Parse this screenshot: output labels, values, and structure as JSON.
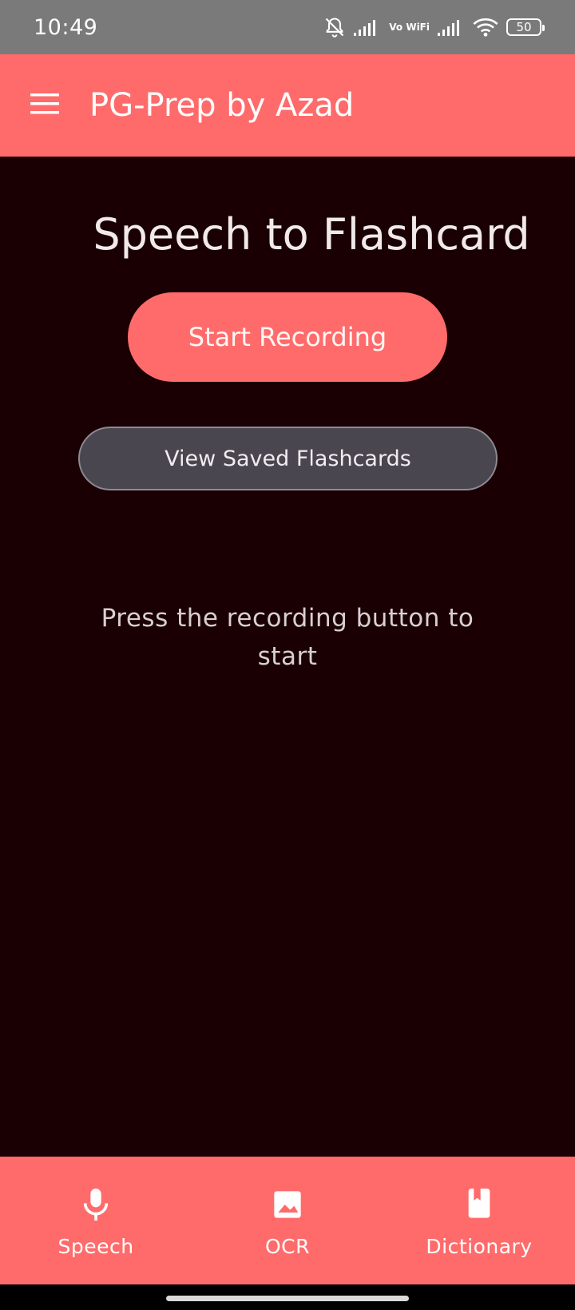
{
  "status_bar": {
    "time": "10:49",
    "vowifi": "Vo WiFi",
    "battery": "50",
    "icons": [
      "bell-off-icon",
      "signal-icon",
      "vowifi-icon",
      "signal-icon",
      "wifi-icon",
      "battery-icon"
    ]
  },
  "app_bar": {
    "title": "PG-Prep by Azad",
    "menu_icon": "hamburger-menu-icon"
  },
  "main": {
    "title": "Speech to Flashcard",
    "start_button": "Start Recording",
    "saved_button": "View Saved Flashcards",
    "hint": "Press the recording button to start"
  },
  "bottom_nav": {
    "items": [
      {
        "label": "Speech",
        "icon": "microphone-icon"
      },
      {
        "label": "OCR",
        "icon": "image-icon"
      },
      {
        "label": "Dictionary",
        "icon": "book-icon"
      }
    ]
  },
  "colors": {
    "accent": "#ff6b6b",
    "background": "#1a0003",
    "secondary_button": "#4a4650",
    "status_bar": "#7a7a7a"
  }
}
